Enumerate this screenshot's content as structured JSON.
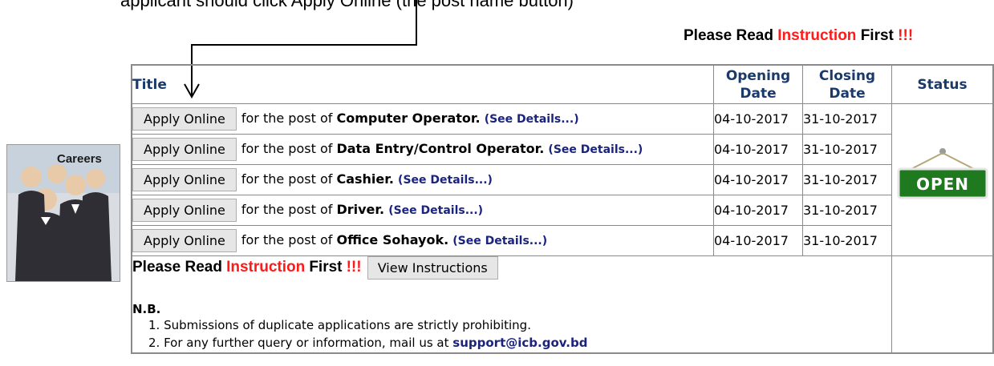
{
  "annotation": {
    "caption": "applicant should click Apply Online (the post name button)"
  },
  "notice": {
    "prefix": "Please Read",
    "highlight": "Instruction",
    "suffix": "First",
    "bangs": "!!!"
  },
  "careers_image": {
    "label": "Careers"
  },
  "table": {
    "headers": {
      "title": "Title",
      "opening_line1": "Opening",
      "opening_line2": "Date",
      "closing_line1": "Closing",
      "closing_line2": "Date",
      "status": "Status"
    },
    "apply_label": "Apply Online",
    "post_prefix": "for the post of",
    "details_label": "(See Details...)",
    "rows": [
      {
        "post": "Computer Operator",
        "opening": "04-10-2017",
        "closing": "31-10-2017"
      },
      {
        "post": "Data Entry/Control Operator",
        "opening": "04-10-2017",
        "closing": "31-10-2017"
      },
      {
        "post": "Cashier",
        "opening": "04-10-2017",
        "closing": "31-10-2017"
      },
      {
        "post": "Driver",
        "opening": "04-10-2017",
        "closing": "31-10-2017"
      },
      {
        "post": "Office Sohayok",
        "opening": "04-10-2017",
        "closing": "31-10-2017"
      }
    ],
    "status_sign": "OPEN",
    "view_instructions": "View Instructions",
    "nb": {
      "title": "N.B.",
      "item1": "1. Submissions of duplicate applications are strictly prohibiting.",
      "item2_prefix": "2. For any further query or information, mail us at",
      "email": "support@icb.gov.bd"
    }
  },
  "colors": {
    "accent_red": "#ff1a1a",
    "header_blue": "#1a3a6b",
    "link_blue": "#1a237e",
    "open_green": "#1f7a1f"
  }
}
